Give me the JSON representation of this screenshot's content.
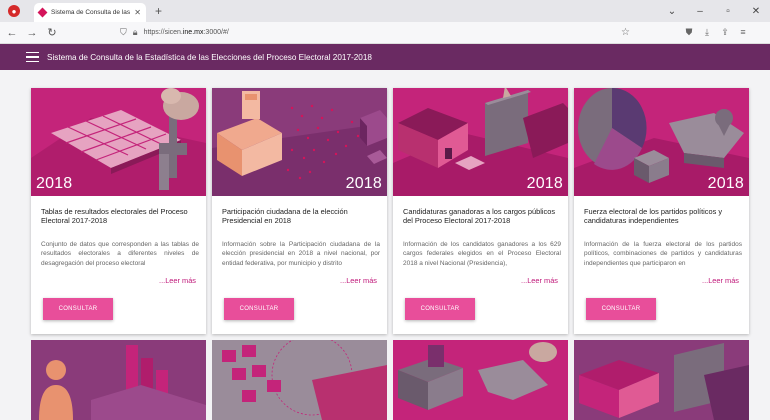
{
  "browser": {
    "tab_title": "Sistema de Consulta de las Esta",
    "tab_close": "✕",
    "new_tab": "+",
    "url_prefix": "https://sicen.",
    "url_host": "ine.mx",
    "url_suffix": ":3000/#/"
  },
  "app": {
    "title": "Sistema de Consulta de la Estadística de las Elecciones del Proceso Electoral 2017-2018"
  },
  "cards": [
    {
      "year": "2018",
      "title": "Tablas de resultados electorales del Proceso Electoral 2017-2018",
      "desc": "Conjunto de datos que corresponden a las tablas de resultados electorales a diferentes niveles de desagregación del proceso electoral",
      "more": "...Leer más",
      "button": "CONSULTAR"
    },
    {
      "year": "2018",
      "title": "Participación ciudadana de la elección Presidencial en 2018",
      "desc": "Información sobre la Participación ciudadana de la elección presidencial en 2018 a nivel nacional, por entidad federativa, por municipio y distrito",
      "more": "...Leer más",
      "button": "CONSULTAR"
    },
    {
      "year": "2018",
      "title": "Candidaturas ganadoras a los cargos públicos del Proceso Electoral 2017-2018",
      "desc": "Información de los candidatos ganadores a los 629 cargos federales elegidos en el Proceso Electoral 2018 a nivel Nacional (Presidencia),",
      "more": "...Leer más",
      "button": "CONSULTAR"
    },
    {
      "year": "2018",
      "title": "Fuerza electoral de los partidos políticos y candidaturas independientes",
      "desc": "Información de la fuerza electoral de los partidos políticos, combinaciones de partidos y candidaturas independientes que participaron en",
      "more": "...Leer más",
      "button": "CONSULTAR"
    }
  ]
}
